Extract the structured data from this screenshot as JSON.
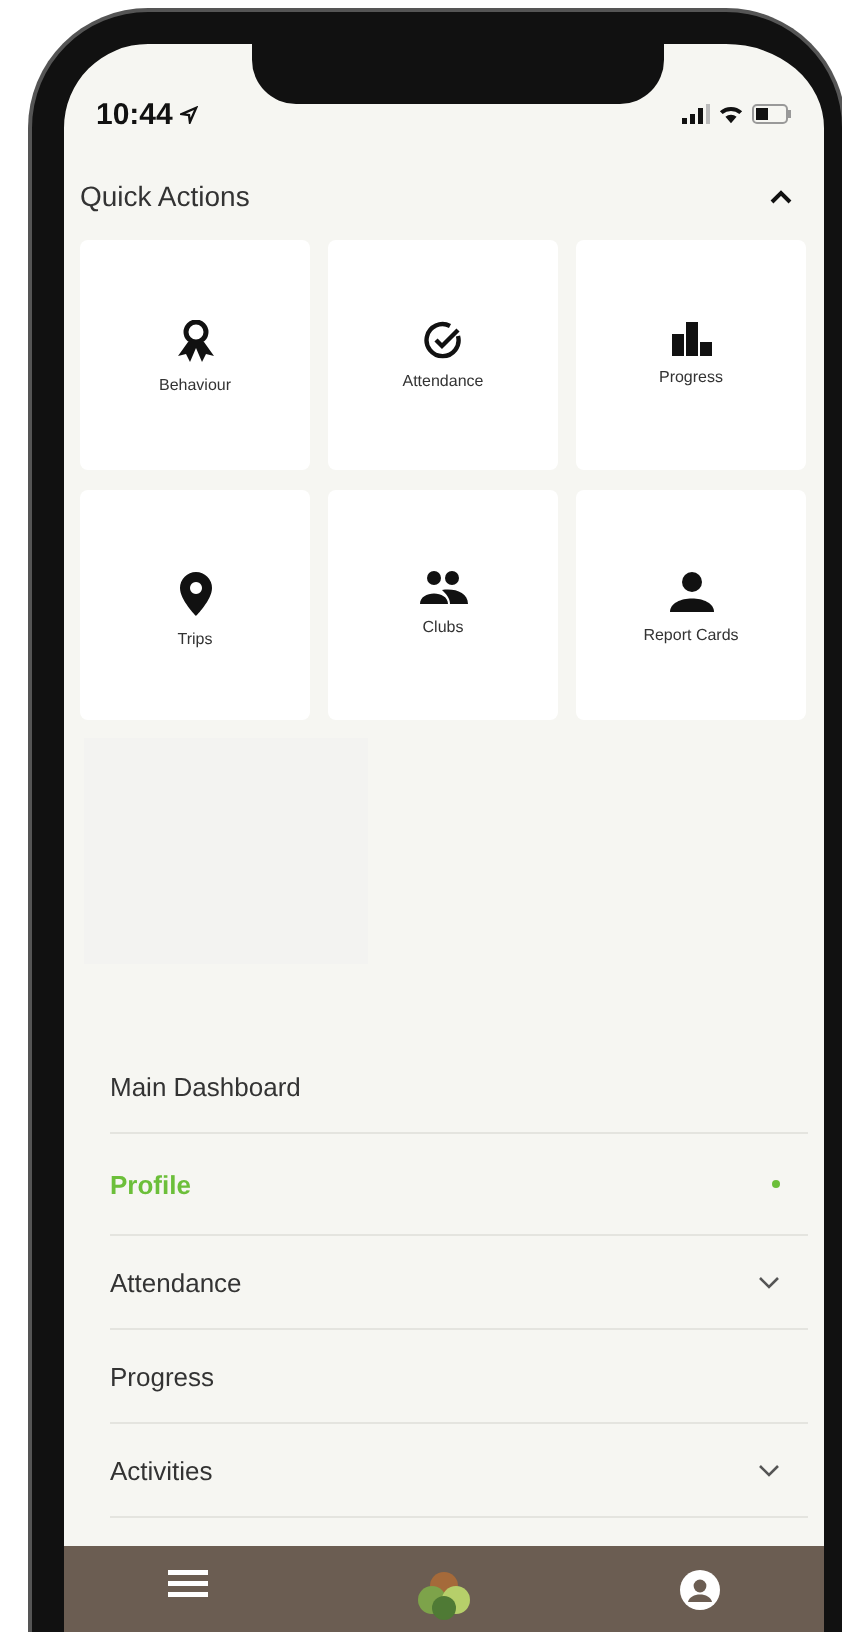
{
  "status_bar": {
    "time": "10:44"
  },
  "quick_actions": {
    "title": "Quick Actions",
    "expanded": true,
    "tiles": [
      {
        "label": "Behaviour",
        "kind": "award"
      },
      {
        "label": "Attendance",
        "kind": "check"
      },
      {
        "label": "Progress",
        "kind": "bars"
      },
      {
        "label": "Trips",
        "kind": "pin"
      },
      {
        "label": "Clubs",
        "kind": "group"
      },
      {
        "label": "Report Cards",
        "kind": "person"
      }
    ]
  },
  "menu": [
    {
      "label": "Main Dashboard",
      "kind": "link",
      "selected": false
    },
    {
      "label": "Profile",
      "kind": "link",
      "selected": true
    },
    {
      "label": "Attendance",
      "kind": "expandable",
      "selected": false
    },
    {
      "label": "Progress",
      "kind": "link",
      "selected": false
    },
    {
      "label": "Activities",
      "kind": "expandable",
      "selected": false
    }
  ]
}
